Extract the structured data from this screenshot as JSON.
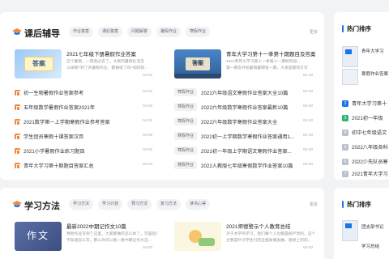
{
  "homework": {
    "title": "课后辅导",
    "tags": [
      "作业答案",
      "课后答案",
      "问题解答",
      "暑假作业",
      "寒假作业"
    ],
    "more": "更多",
    "featured": [
      {
        "thumb_text": "答案",
        "title": "2021七年级下册暑假作业答案",
        "desc": [
          "这个暑假，一晃就过去了，大家的暑假生活怎",
          "么样呢?到了开暑假作业，都做得了吗?如何的..."
        ],
        "date": "04-02"
      },
      {
        "thumb_text": "答案",
        "title": "青年大学习第十一季第十期题目及答案",
        "desc": [
          "2021青年大学习第十一季第十一期如何进...",
          "第一都会开始暑假暑期答一期，大家答题的方可"
        ],
        "date": "04-02"
      }
    ],
    "left_list": [
      {
        "title": "初一生物暑假作业答案参考",
        "date": "04-02"
      },
      {
        "title": "五年级数学暑假作业答案2021年",
        "date": "04-02"
      },
      {
        "title": "2021数学第一上学期寒假作业参考答案",
        "date": "04-02"
      },
      {
        "title": "学生团员寒假十课答案汉页",
        "date": "04-02"
      },
      {
        "title": "2021小学暑假作业练习题目",
        "date": "04-02"
      },
      {
        "title": "青年大学习第十期题目答案汇总",
        "date": "04-02"
      }
    ],
    "right_list": [
      {
        "tag": "寒假作业",
        "title": "2022六年级语文寒假作业答案大全10篇",
        "date": "04-02"
      },
      {
        "tag": "寒假作业",
        "title": "2022六年级数学寒假作业答案最新10篇",
        "date": "04-02"
      },
      {
        "tag": "寒假作业",
        "title": "2022六年级数学寒假作业答案大全",
        "date": "04-02"
      },
      {
        "tag": "寒假作业",
        "title": "2022初一上学期数学寒假作业答案通用1...",
        "date": "04-02"
      },
      {
        "tag": "寒假作业",
        "title": "2021初一年级上学期语文寒假作业答案...",
        "date": "04-02"
      },
      {
        "tag": "寒假作业",
        "title": "2022人教版七年级寒假数学作业答案10篇",
        "date": "04-02"
      }
    ]
  },
  "study": {
    "title": "学习方法",
    "tags": [
      "学习方法",
      "学习计划",
      "预习方法",
      "复习方法",
      "读书心得"
    ],
    "more": "更多",
    "featured": [
      {
        "thumb_text": "作文",
        "title": "最新2022中期记作文10篇",
        "desc": [
          "寒假作业写到了这里，大家都做的怎么样了，可是后来人",
          "不知道怎么写，那么你可以看一看中期记作文这..."
        ],
        "date": "04-02"
      },
      {
        "title": "2021师德警示个人教育总结",
        "desc": [
          "对于本学的学习，我们每个人也都是很严肃的，这个",
          "主要是针对学生们的全面发展发展，思想上的的..."
        ],
        "date": "04-02"
      }
    ]
  },
  "sidebar1": {
    "title": "热门排序",
    "items": [
      "青年大学习第十",
      "2021初一年级",
      "初中七年级语文",
      "2022八年级各科",
      "2022少先队员寒",
      "2021青年大学习"
    ],
    "cover_titles": [
      "青年大学习",
      "寒假作业答案"
    ]
  },
  "sidebar2": {
    "title": "热门排序",
    "cover_titles": [
      "团支部书记",
      "学习总结"
    ]
  },
  "colors": {
    "accent_orange": "#f08a3c",
    "brand_blue": "#1a73e8",
    "bg": "#f2f3f5"
  }
}
